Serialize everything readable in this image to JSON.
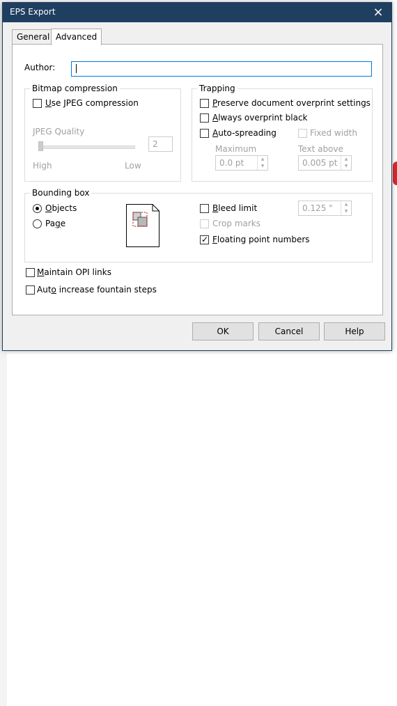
{
  "dialog": {
    "title": "EPS Export",
    "close_icon": "×"
  },
  "tabs": [
    {
      "label": "General",
      "active": false
    },
    {
      "label": "Advanced",
      "active": true
    }
  ],
  "author": {
    "label": "Author:",
    "value": ""
  },
  "bitmap": {
    "group_title": "Bitmap compression",
    "use_jpeg_label": "Use JPEG compression",
    "use_jpeg_checked": false,
    "quality_label": "JPEG Quality",
    "quality_value": "2",
    "high_label": "High",
    "low_label": "Low"
  },
  "trapping": {
    "group_title": "Trapping",
    "preserve_label": "Preserve document overprint settings",
    "always_label": "Always overprint black",
    "auto_label": "Auto-spreading",
    "fixed_width_label": "Fixed width",
    "maximum_label": "Maximum",
    "maximum_value": "0.0 pt",
    "text_above_label": "Text above",
    "text_above_value": "0.005 pt"
  },
  "bounding": {
    "group_title": "Bounding box",
    "objects_label": "Objects",
    "page_label": "Page",
    "selected": "Objects",
    "bleed_label": "Bleed limit",
    "bleed_value": "0.125 \"",
    "crop_label": "Crop marks",
    "floating_label": "Floating point numbers",
    "floating_checked": true
  },
  "options": {
    "opi_label": "Maintain OPI links",
    "fountain_label": "Auto increase fountain steps"
  },
  "buttons": {
    "ok": "OK",
    "cancel": "Cancel",
    "help": "Help"
  },
  "colors": {
    "titlebar": "#1f3f61",
    "focus": "#0078d7"
  }
}
